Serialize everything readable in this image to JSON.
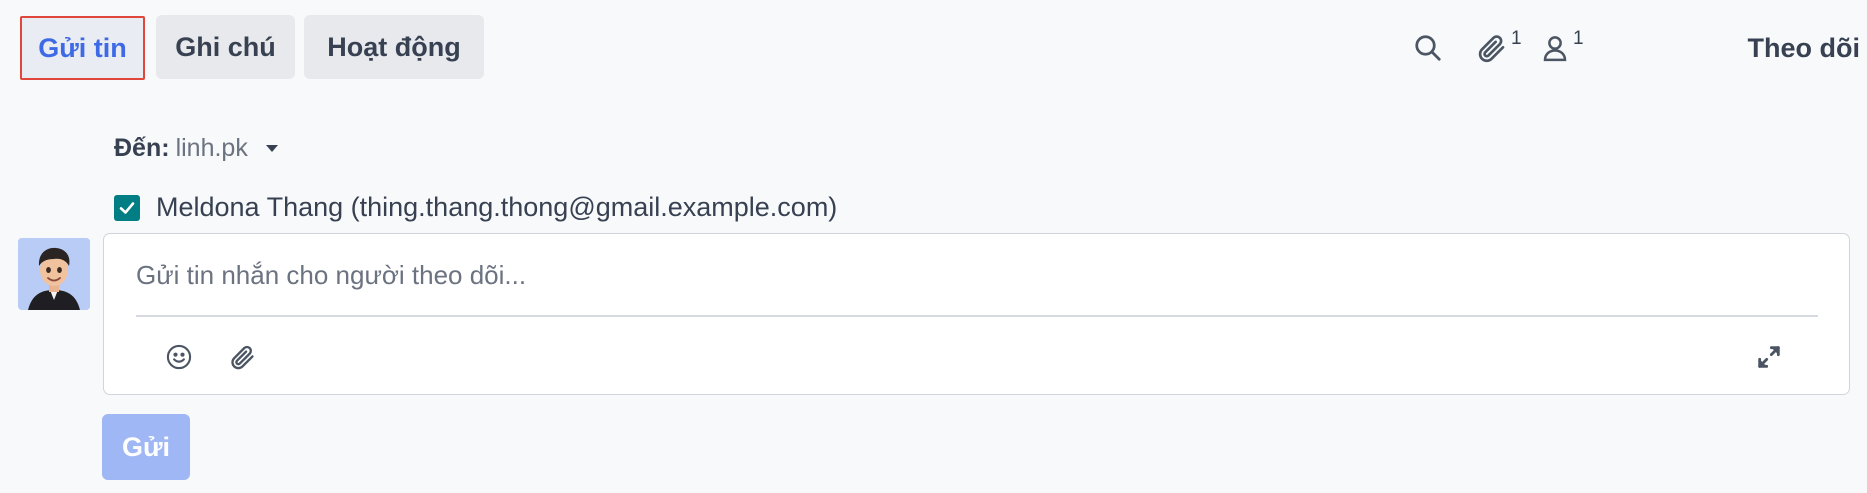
{
  "tabs": {
    "send_message": "Gửi tin",
    "log_note": "Ghi chú",
    "activities": "Hoạt động"
  },
  "toolbar": {
    "search_icon": "search-icon",
    "attachments_icon": "paperclip-icon",
    "attachments_count": "1",
    "followers_icon": "user-icon",
    "followers_count": "1",
    "follow_label": "Theo dõi"
  },
  "recipients": {
    "to_label": "Đến:",
    "to_value": "linh.pk",
    "suggested": [
      {
        "checked": true,
        "label": "Meldona Thang (thing.thang.thong@gmail.example.com)"
      }
    ]
  },
  "composer": {
    "placeholder": "Gửi tin nhắn cho người theo dõi...",
    "value": "",
    "tools": [
      "smile-icon",
      "paperclip-icon",
      "expand-icon"
    ]
  },
  "send_button": "Gửi",
  "colors": {
    "accent": "#3f6ae6",
    "highlight_border": "#e0463c",
    "checkbox": "#017e84",
    "send_disabled": "#9fb7f5"
  }
}
